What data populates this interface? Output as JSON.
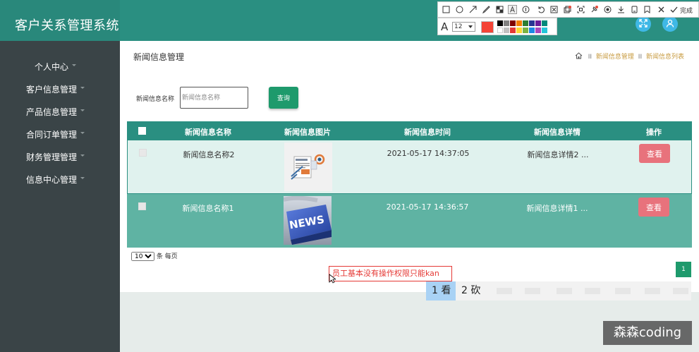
{
  "header": {
    "app_title": "客户关系管理系统",
    "fullscreen_icon": "expand-icon",
    "user_icon": "user-icon"
  },
  "sidebar": {
    "items": [
      {
        "label": "个人中心"
      },
      {
        "label": "客户信息管理"
      },
      {
        "label": "产品信息管理"
      },
      {
        "label": "合同订单管理"
      },
      {
        "label": "财务管理管理"
      },
      {
        "label": "信息中心管理"
      }
    ]
  },
  "main": {
    "title": "新闻信息管理",
    "breadcrumb": {
      "home_icon": "home-icon",
      "sep": "II",
      "level1": "新闻信息管理",
      "level2": "新闻信息列表"
    },
    "search": {
      "label": "新闻信息名称",
      "placeholder": "新闻信息名称",
      "button": "查询"
    },
    "table": {
      "headers": [
        "新闻信息名称",
        "新闻信息图片",
        "新闻信息时间",
        "新闻信息详情",
        "操作"
      ],
      "rows": [
        {
          "name": "新闻信息名称2",
          "image_icon": "news-illustration-icon",
          "time": "2021-05-17 14:37:05",
          "detail": "新闻信息详情2 ...",
          "action": "查看"
        },
        {
          "name": "新闻信息名称1",
          "image_icon": "news-keyboard-icon",
          "image_text": "NEWS",
          "time": "2021-05-17 14:36:57",
          "detail": "新闻信息详情1 ...",
          "action": "查看"
        }
      ]
    },
    "pager": {
      "page_size": "10",
      "suffix": "条 每页",
      "current_page": "1"
    }
  },
  "overlay": {
    "annotation_text": "员工基本没有操作权限只能kan",
    "ime": {
      "cand1": "1 看",
      "cand2": "2 砍"
    },
    "toolbar": {
      "tools": [
        "rectangle-icon",
        "ellipse-icon",
        "arrow-icon",
        "pen-icon",
        "mosaic-icon",
        "text-icon",
        "number-icon",
        "undo-icon",
        "pin-icon",
        "copy-icon",
        "ocr-icon",
        "pin-tool-icon",
        "record-icon",
        "download-icon",
        "save-icon",
        "bookmark-icon",
        "close-icon",
        "check-icon"
      ],
      "done_label": "完成",
      "font_size": "12",
      "current_color": "#f44336"
    },
    "watermark": "森森coding"
  },
  "colors": {
    "primary": "#2a8f81",
    "sidebar": "#3a4447",
    "view_button": "#e8727c",
    "search_button": "#1e9a6c"
  }
}
